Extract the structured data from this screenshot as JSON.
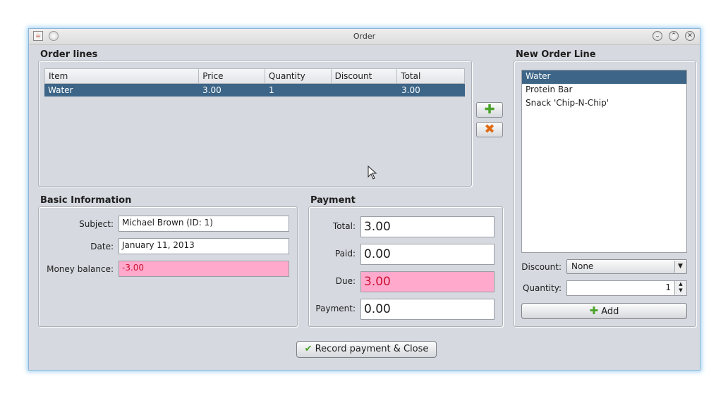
{
  "window": {
    "title": "Order"
  },
  "order_lines": {
    "label": "Order lines",
    "columns": [
      "Item",
      "Price",
      "Quantity",
      "Discount",
      "Total"
    ],
    "rows": [
      {
        "item": "Water",
        "price": "3.00",
        "quantity": "1",
        "discount": "",
        "total": "3.00",
        "selected": true
      }
    ]
  },
  "new_order_line": {
    "label": "New Order Line",
    "items": [
      "Water",
      "Protein Bar",
      "Snack 'Chip-N-Chip'"
    ],
    "selected_index": 0,
    "discount_label": "Discount:",
    "discount_value": "None",
    "quantity_label": "Quantity:",
    "quantity_value": "1",
    "add_label": "Add"
  },
  "basic_info": {
    "label": "Basic Information",
    "subject_label": "Subject:",
    "subject_value": "Michael Brown (ID: 1)",
    "date_label": "Date:",
    "date_value": "January 11, 2013",
    "balance_label": "Money balance:",
    "balance_value": "-3.00"
  },
  "payment": {
    "label": "Payment",
    "total_label": "Total:",
    "total_value": "3.00",
    "paid_label": "Paid:",
    "paid_value": "0.00",
    "due_label": "Due:",
    "due_value": "3.00",
    "payment_label": "Payment:",
    "payment_value": "0.00"
  },
  "footer": {
    "record_label": "Record payment & Close"
  },
  "colors": {
    "selection": "#3c6587",
    "warning_bg": "#ffaacc",
    "warning_text": "#cc1133",
    "add_icon": "#4aa32a",
    "remove_icon": "#e06a10"
  }
}
